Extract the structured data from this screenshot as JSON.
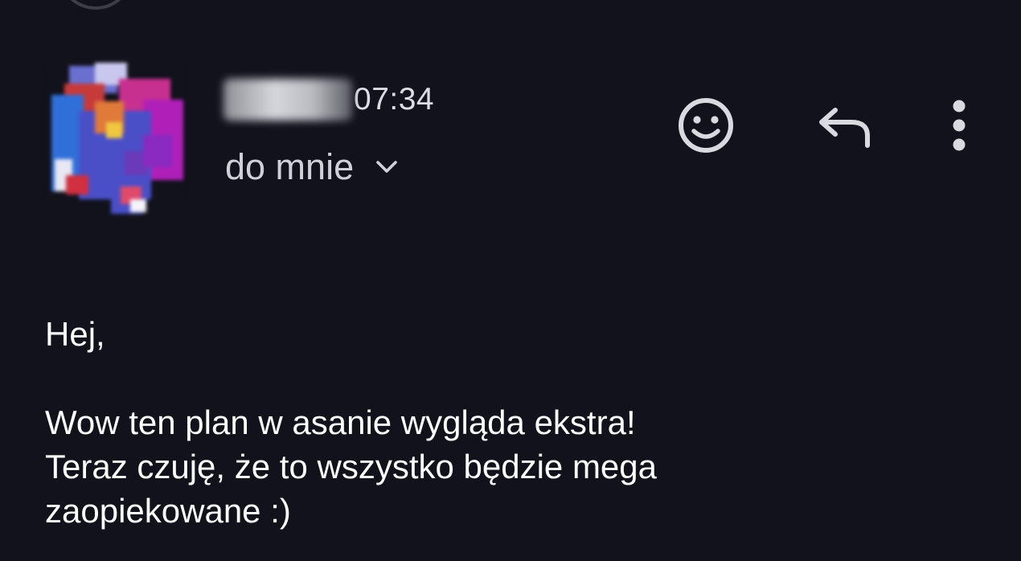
{
  "email": {
    "sender": {
      "name": "",
      "time": "07:34",
      "avatar_icon": "avatar-image"
    },
    "recipient": {
      "label": "do mnie",
      "expand_icon": "chevron-down-icon"
    },
    "actions": {
      "emoji_icon": "smiley-icon",
      "reply_icon": "reply-icon",
      "more_icon": "more-vertical-icon"
    },
    "body": {
      "greeting": "Hej,",
      "lines": [
        "Wow ten plan w asanie wygląda ekstra!",
        "Teraz czuję, że to wszystko będzie mega",
        "zaopiekowane :)"
      ]
    }
  },
  "colors": {
    "background": "#11121c",
    "text_primary": "#ffffff",
    "text_secondary": "#cfd1d7",
    "icon": "#d8dae0"
  }
}
